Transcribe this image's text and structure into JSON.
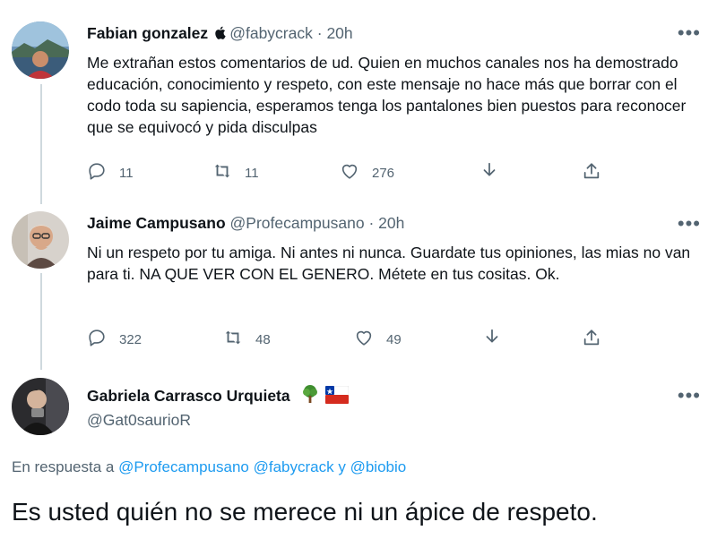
{
  "tweets": [
    {
      "name": "Fabian gonzalez",
      "handle": "@fabycrack",
      "time": "20h",
      "text": "Me extrañan estos comentarios de ud. Quien en muchos canales nos ha demostrado educación, conocimiento y respeto, con este mensaje no hace más que borrar con el codo toda su sapiencia, esperamos tenga los pantalones bien puestos para reconocer que se equivocó y pida disculpas",
      "replies": "11",
      "retweets": "11",
      "likes": "276"
    },
    {
      "name": "Jaime Campusano",
      "handle": "@Profecampusano",
      "time": "20h",
      "text": "Ni un respeto por tu amiga. Ni antes ni nunca. Guardate tus opiniones, las mias no van para ti. NA  QUE VER CON EL GENERO. Métete en tus cositas. Ok.",
      "replies": "322",
      "retweets": "48",
      "likes": "49"
    }
  ],
  "main_tweet": {
    "name": "Gabriela Carrasco Urquieta",
    "handle": "@Gat0saurioR",
    "reply_prefix": "En respuesta a",
    "reply_users": [
      "@Profecampusano",
      "@fabycrack",
      "y",
      "@biobio"
    ],
    "text": "Es usted quién no se merece ni un ápice de respeto."
  },
  "icons": {
    "more": "more-dots-icon",
    "reply": "reply-icon",
    "retweet": "retweet-icon",
    "like": "heart-icon",
    "save": "bookmark-down-icon",
    "share": "share-icon"
  },
  "colors": {
    "text": "#0f1419",
    "secondary": "#536471",
    "link": "#1d9bf0",
    "thread_line": "#cfd9de"
  }
}
